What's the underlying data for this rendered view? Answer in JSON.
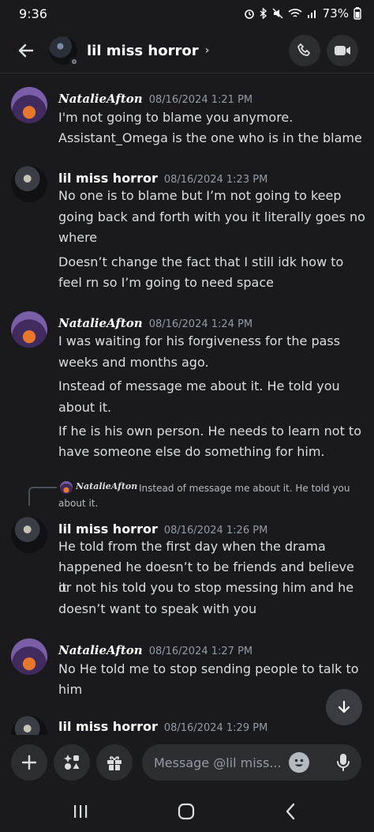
{
  "status": {
    "time": "9:36",
    "battery": "73%"
  },
  "header": {
    "title": "lil miss horror",
    "chevron": "›"
  },
  "messages": [
    {
      "author": "NatalieAfton",
      "timestamp": "08/16/2024 1:21 PM",
      "lines": [
        "I'm not going to blame you anymore.",
        "Assistant_Omega is the one who is in the blame"
      ]
    },
    {
      "author": "lil miss horror",
      "timestamp": "08/16/2024 1:23 PM",
      "lines": [
        "No one is to blame but I’m not going to keep",
        "going back and forth with you it literally goes no",
        "where",
        "Doesn’t change the fact that I still idk how to",
        "feel rn so I’m going to need space"
      ]
    },
    {
      "author": "NatalieAfton",
      "timestamp": "08/16/2024 1:24 PM",
      "lines": [
        "I was waiting for his forgiveness for the pass",
        "weeks and months ago.",
        "Instead of message me about it. He told you",
        "about it.",
        "If he is his own person. He needs to learn not to",
        "have someone else do something for him."
      ]
    },
    {
      "author": "lil miss horror",
      "timestamp": "08/16/2024 1:26 PM",
      "lines": [
        "He told from the first day when the drama",
        "happened he doesn’t to be friends and believe it",
        "or not his told you to stop messing him and he",
        "doesn’t want to speak with you"
      ]
    },
    {
      "author": "NatalieAfton",
      "timestamp": "08/16/2024 1:27 PM",
      "lines": [
        "No He told me to stop sending people to talk to",
        "him"
      ]
    },
    {
      "author": "lil miss horror",
      "timestamp": "08/16/2024 1:29 PM",
      "lines": []
    }
  ],
  "reply": {
    "author": "NatalieAfton",
    "text": "Instead of message me about it. He told you",
    "text_cont": "about it."
  },
  "composer": {
    "placeholder": "Message @lil miss..."
  },
  "icons": [
    "back-arrow-icon",
    "call-icon",
    "video-icon",
    "plus-icon",
    "apps-icon",
    "gift-icon",
    "emoji-icon",
    "mic-icon",
    "arrow-down-icon",
    "nav-recents-icon",
    "nav-home-icon",
    "nav-back-icon"
  ]
}
